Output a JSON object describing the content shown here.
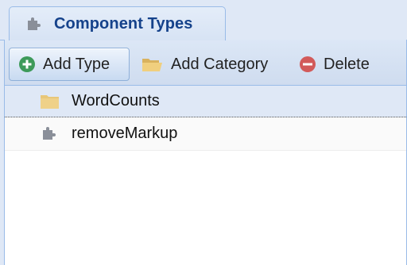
{
  "tab": {
    "label": "Component Types",
    "icon": "puzzle-piece-icon"
  },
  "toolbar": {
    "add_type_label": "Add Type",
    "add_category_label": "Add Category",
    "delete_label": "Delete",
    "icons": {
      "add_type": "plus-circle-icon",
      "add_category": "open-folder-icon",
      "delete": "minus-circle-icon"
    }
  },
  "tree": {
    "items": [
      {
        "label": "WordCounts",
        "icon": "folder-icon",
        "selected": true
      },
      {
        "label": "removeMarkup",
        "icon": "puzzle-piece-icon",
        "selected": false
      }
    ]
  },
  "colors": {
    "tab_text": "#15428b",
    "panel_bg": "#dfe8f6",
    "border": "#99bbe8",
    "add_green": "#3d9a5a",
    "delete_red": "#d25a5a",
    "folder": "#e8c779"
  }
}
